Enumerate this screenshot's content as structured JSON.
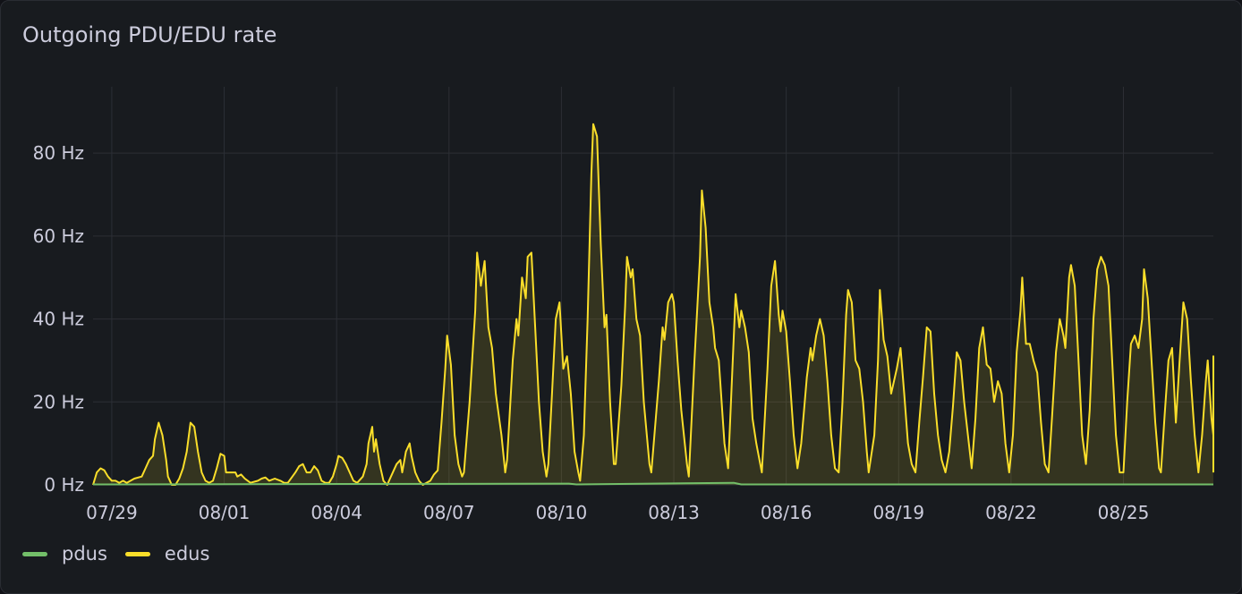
{
  "panel": {
    "title": "Outgoing PDU/EDU rate"
  },
  "legend": [
    {
      "label": "pdus",
      "color": "#73bf69"
    },
    {
      "label": "edus",
      "color": "#fade2a"
    }
  ],
  "chart_data": {
    "type": "area",
    "x_ticks": [
      "07/29",
      "08/01",
      "08/04",
      "08/07",
      "08/10",
      "08/13",
      "08/16",
      "08/19",
      "08/22",
      "08/25"
    ],
    "x_tick_days": [
      1,
      4,
      7,
      10,
      13,
      16,
      19,
      22,
      25,
      28
    ],
    "y_ticks": [
      "0 Hz",
      "20 Hz",
      "40 Hz",
      "60 Hz",
      "80 Hz"
    ],
    "y_tick_values": [
      0,
      20,
      40,
      60,
      80
    ],
    "ylim": [
      0,
      96
    ],
    "xlim_days": [
      0.5,
      30.4
    ],
    "grid": true,
    "legend_position": "bottom-left",
    "series": [
      {
        "name": "pdus",
        "color": "#73bf69",
        "points": [
          [
            0.5,
            0.1
          ],
          [
            13.2,
            0.3
          ],
          [
            13.4,
            0.1
          ],
          [
            17.6,
            0.5
          ],
          [
            17.8,
            0.1
          ],
          [
            30.4,
            0.1
          ]
        ]
      },
      {
        "name": "edus",
        "color": "#fade2a",
        "points": [
          [
            0.5,
            0
          ],
          [
            0.6,
            3
          ],
          [
            0.7,
            4
          ],
          [
            0.8,
            3.5
          ],
          [
            0.9,
            2
          ],
          [
            1.0,
            1
          ],
          [
            1.1,
            1
          ],
          [
            1.2,
            0.5
          ],
          [
            1.3,
            1
          ],
          [
            1.4,
            0.5
          ],
          [
            1.5,
            1
          ],
          [
            1.6,
            1.5
          ],
          [
            1.8,
            2
          ],
          [
            1.9,
            4
          ],
          [
            2.0,
            6
          ],
          [
            2.1,
            7
          ],
          [
            2.15,
            11
          ],
          [
            2.25,
            15
          ],
          [
            2.35,
            12
          ],
          [
            2.45,
            6
          ],
          [
            2.5,
            2
          ],
          [
            2.6,
            0
          ],
          [
            2.7,
            0
          ],
          [
            2.8,
            1.5
          ],
          [
            2.9,
            4
          ],
          [
            3.0,
            8
          ],
          [
            3.1,
            15
          ],
          [
            3.2,
            14
          ],
          [
            3.3,
            8
          ],
          [
            3.4,
            3
          ],
          [
            3.5,
            1
          ],
          [
            3.6,
            0.5
          ],
          [
            3.7,
            1
          ],
          [
            3.8,
            4
          ],
          [
            3.9,
            7.5
          ],
          [
            4.0,
            7
          ],
          [
            4.05,
            3
          ],
          [
            4.15,
            3
          ],
          [
            4.3,
            3
          ],
          [
            4.35,
            2
          ],
          [
            4.45,
            2.5
          ],
          [
            4.55,
            1.5
          ],
          [
            4.7,
            0.5
          ],
          [
            4.9,
            1
          ],
          [
            5.0,
            1.5
          ],
          [
            5.1,
            1.8
          ],
          [
            5.2,
            1
          ],
          [
            5.35,
            1.5
          ],
          [
            5.5,
            1
          ],
          [
            5.6,
            0.5
          ],
          [
            5.7,
            0.5
          ],
          [
            5.9,
            3
          ],
          [
            6.0,
            4.5
          ],
          [
            6.1,
            5
          ],
          [
            6.2,
            3
          ],
          [
            6.3,
            3
          ],
          [
            6.4,
            4.5
          ],
          [
            6.5,
            3.5
          ],
          [
            6.6,
            1
          ],
          [
            6.7,
            0.5
          ],
          [
            6.8,
            0.5
          ],
          [
            6.9,
            2
          ],
          [
            7.0,
            5
          ],
          [
            7.05,
            7
          ],
          [
            7.15,
            6.5
          ],
          [
            7.25,
            5
          ],
          [
            7.35,
            3
          ],
          [
            7.45,
            1
          ],
          [
            7.55,
            0.5
          ],
          [
            7.7,
            2
          ],
          [
            7.8,
            5
          ],
          [
            7.85,
            10
          ],
          [
            7.95,
            14
          ],
          [
            8.0,
            8
          ],
          [
            8.05,
            11
          ],
          [
            8.15,
            5
          ],
          [
            8.25,
            1
          ],
          [
            8.35,
            0
          ],
          [
            8.5,
            3
          ],
          [
            8.6,
            5
          ],
          [
            8.7,
            6
          ],
          [
            8.75,
            3
          ],
          [
            8.85,
            8
          ],
          [
            8.95,
            10
          ],
          [
            9.0,
            7
          ],
          [
            9.1,
            3
          ],
          [
            9.2,
            1
          ],
          [
            9.3,
            0
          ],
          [
            9.5,
            1
          ],
          [
            9.6,
            2.5
          ],
          [
            9.7,
            3.5
          ],
          [
            9.8,
            15
          ],
          [
            9.9,
            28
          ],
          [
            9.95,
            36
          ],
          [
            10.05,
            29
          ],
          [
            10.15,
            12
          ],
          [
            10.25,
            5
          ],
          [
            10.35,
            2
          ],
          [
            10.4,
            3
          ],
          [
            10.55,
            20
          ],
          [
            10.7,
            42
          ],
          [
            10.75,
            56
          ],
          [
            10.85,
            48
          ],
          [
            10.95,
            54
          ],
          [
            11.05,
            38
          ],
          [
            11.15,
            33
          ],
          [
            11.25,
            22
          ],
          [
            11.4,
            12
          ],
          [
            11.5,
            3
          ],
          [
            11.55,
            6
          ],
          [
            11.7,
            30
          ],
          [
            11.8,
            40
          ],
          [
            11.85,
            36
          ],
          [
            11.95,
            50
          ],
          [
            12.05,
            45
          ],
          [
            12.1,
            55
          ],
          [
            12.2,
            56
          ],
          [
            12.3,
            38
          ],
          [
            12.4,
            20
          ],
          [
            12.5,
            8
          ],
          [
            12.6,
            2
          ],
          [
            12.65,
            5
          ],
          [
            12.75,
            22
          ],
          [
            12.85,
            40
          ],
          [
            12.95,
            44
          ],
          [
            13.05,
            28
          ],
          [
            13.15,
            31
          ],
          [
            13.25,
            22
          ],
          [
            13.35,
            8
          ],
          [
            13.45,
            3
          ],
          [
            13.5,
            1
          ],
          [
            13.6,
            12
          ],
          [
            13.7,
            40
          ],
          [
            13.8,
            75
          ],
          [
            13.85,
            87
          ],
          [
            13.95,
            84
          ],
          [
            14.05,
            58
          ],
          [
            14.15,
            38
          ],
          [
            14.2,
            41
          ],
          [
            14.3,
            20
          ],
          [
            14.4,
            5
          ],
          [
            14.45,
            5
          ],
          [
            14.6,
            24
          ],
          [
            14.7,
            43
          ],
          [
            14.75,
            55
          ],
          [
            14.85,
            50
          ],
          [
            14.9,
            52
          ],
          [
            15.0,
            40
          ],
          [
            15.1,
            36
          ],
          [
            15.2,
            20
          ],
          [
            15.35,
            5
          ],
          [
            15.4,
            3
          ],
          [
            15.6,
            25
          ],
          [
            15.7,
            38
          ],
          [
            15.75,
            35
          ],
          [
            15.85,
            44
          ],
          [
            15.95,
            46
          ],
          [
            16.0,
            44
          ],
          [
            16.1,
            30
          ],
          [
            16.2,
            18
          ],
          [
            16.35,
            5
          ],
          [
            16.4,
            2
          ],
          [
            16.55,
            30
          ],
          [
            16.7,
            55
          ],
          [
            16.75,
            71
          ],
          [
            16.85,
            62
          ],
          [
            16.95,
            44
          ],
          [
            17.05,
            38
          ],
          [
            17.1,
            33
          ],
          [
            17.2,
            30
          ],
          [
            17.35,
            10
          ],
          [
            17.45,
            4
          ],
          [
            17.55,
            25
          ],
          [
            17.65,
            46
          ],
          [
            17.75,
            38
          ],
          [
            17.8,
            42
          ],
          [
            17.9,
            38
          ],
          [
            18.0,
            32
          ],
          [
            18.1,
            16
          ],
          [
            18.2,
            10
          ],
          [
            18.35,
            3
          ],
          [
            18.5,
            28
          ],
          [
            18.6,
            48
          ],
          [
            18.7,
            54
          ],
          [
            18.8,
            41
          ],
          [
            18.85,
            37
          ],
          [
            18.9,
            42
          ],
          [
            19.0,
            37
          ],
          [
            19.1,
            25
          ],
          [
            19.2,
            12
          ],
          [
            19.3,
            4
          ],
          [
            19.4,
            10
          ],
          [
            19.55,
            26
          ],
          [
            19.65,
            33
          ],
          [
            19.7,
            30
          ],
          [
            19.8,
            36
          ],
          [
            19.9,
            40
          ],
          [
            20.0,
            36
          ],
          [
            20.1,
            25
          ],
          [
            20.2,
            12
          ],
          [
            20.3,
            4
          ],
          [
            20.4,
            3
          ],
          [
            20.5,
            20
          ],
          [
            20.6,
            41
          ],
          [
            20.65,
            47
          ],
          [
            20.75,
            44
          ],
          [
            20.85,
            30
          ],
          [
            20.95,
            28
          ],
          [
            21.05,
            20
          ],
          [
            21.15,
            8
          ],
          [
            21.2,
            3
          ],
          [
            21.35,
            12
          ],
          [
            21.45,
            30
          ],
          [
            21.5,
            47
          ],
          [
            21.6,
            35
          ],
          [
            21.7,
            31
          ],
          [
            21.8,
            22
          ],
          [
            21.95,
            28
          ],
          [
            22.05,
            33
          ],
          [
            22.15,
            22
          ],
          [
            22.25,
            10
          ],
          [
            22.35,
            5
          ],
          [
            22.45,
            3
          ],
          [
            22.55,
            15
          ],
          [
            22.65,
            26
          ],
          [
            22.75,
            38
          ],
          [
            22.85,
            37
          ],
          [
            22.95,
            22
          ],
          [
            23.05,
            12
          ],
          [
            23.15,
            6
          ],
          [
            23.25,
            3
          ],
          [
            23.35,
            8
          ],
          [
            23.45,
            19
          ],
          [
            23.55,
            32
          ],
          [
            23.65,
            30
          ],
          [
            23.75,
            20
          ],
          [
            23.85,
            12
          ],
          [
            23.95,
            4
          ],
          [
            24.05,
            16
          ],
          [
            24.15,
            33
          ],
          [
            24.25,
            38
          ],
          [
            24.35,
            29
          ],
          [
            24.45,
            28
          ],
          [
            24.55,
            20
          ],
          [
            24.65,
            25
          ],
          [
            24.75,
            22
          ],
          [
            24.85,
            10
          ],
          [
            24.95,
            3
          ],
          [
            25.05,
            12
          ],
          [
            25.15,
            32
          ],
          [
            25.25,
            42
          ],
          [
            25.3,
            50
          ],
          [
            25.4,
            34
          ],
          [
            25.5,
            34
          ],
          [
            25.6,
            30
          ],
          [
            25.7,
            27
          ],
          [
            25.8,
            15
          ],
          [
            25.9,
            5
          ],
          [
            26.0,
            3
          ],
          [
            26.1,
            17
          ],
          [
            26.2,
            32
          ],
          [
            26.3,
            40
          ],
          [
            26.4,
            36
          ],
          [
            26.45,
            33
          ],
          [
            26.55,
            50
          ],
          [
            26.6,
            53
          ],
          [
            26.7,
            48
          ],
          [
            26.8,
            30
          ],
          [
            26.9,
            12
          ],
          [
            27.0,
            5
          ],
          [
            27.1,
            18
          ],
          [
            27.2,
            40
          ],
          [
            27.3,
            52
          ],
          [
            27.4,
            55
          ],
          [
            27.5,
            53
          ],
          [
            27.6,
            48
          ],
          [
            27.7,
            30
          ],
          [
            27.8,
            12
          ],
          [
            27.9,
            3
          ],
          [
            28.0,
            3
          ],
          [
            28.1,
            20
          ],
          [
            28.2,
            34
          ],
          [
            28.3,
            36
          ],
          [
            28.4,
            33
          ],
          [
            28.5,
            40
          ],
          [
            28.55,
            52
          ],
          [
            28.65,
            45
          ],
          [
            28.75,
            30
          ],
          [
            28.85,
            15
          ],
          [
            28.95,
            4
          ],
          [
            29.0,
            3
          ],
          [
            29.1,
            17
          ],
          [
            29.2,
            30
          ],
          [
            29.3,
            33
          ],
          [
            29.4,
            15
          ],
          [
            29.5,
            30
          ],
          [
            29.6,
            44
          ],
          [
            29.7,
            40
          ],
          [
            29.8,
            25
          ],
          [
            29.9,
            12
          ],
          [
            30.0,
            3
          ],
          [
            30.1,
            12
          ],
          [
            30.2,
            25
          ],
          [
            30.25,
            30
          ],
          [
            30.35,
            16
          ],
          [
            30.45,
            12
          ],
          [
            30.55,
            18
          ],
          [
            30.65,
            31
          ],
          [
            30.75,
            29
          ],
          [
            30.85,
            16
          ],
          [
            30.95,
            3
          ],
          [
            31.05,
            17
          ]
        ]
      }
    ]
  }
}
